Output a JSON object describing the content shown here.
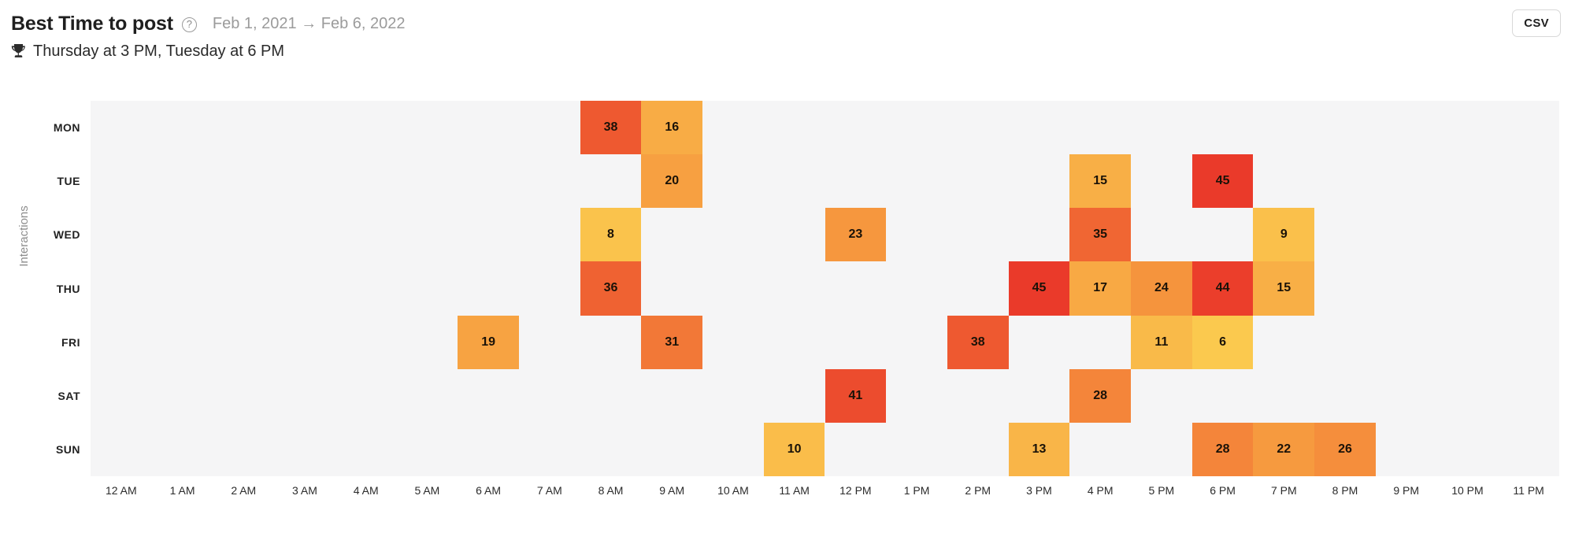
{
  "header": {
    "title": "Best Time to post",
    "help_icon": "question-circle-icon",
    "date_range": "Feb 1, 2021 → Feb 6, 2022",
    "csv_label": "CSV"
  },
  "subtitle": {
    "trophy_icon": "trophy-icon",
    "text": "Thursday at 3 PM, Tuesday at 6 PM"
  },
  "chart_data": {
    "type": "heatmap",
    "title": "Best Time to post",
    "subtitle": "Thursday at 3 PM, Tuesday at 6 PM",
    "xlabel": "",
    "ylabel": "Interactions",
    "date_range": "Feb 1, 2021 → Feb 6, 2022",
    "grid": false,
    "legend": "none",
    "x_categories": [
      "12 AM",
      "1 AM",
      "2 AM",
      "3 AM",
      "4 AM",
      "5 AM",
      "6 AM",
      "7 AM",
      "8 AM",
      "9 AM",
      "10 AM",
      "11 AM",
      "12 PM",
      "1 PM",
      "2 PM",
      "3 PM",
      "4 PM",
      "5 PM",
      "6 PM",
      "7 PM",
      "8 PM",
      "9 PM",
      "10 PM",
      "11 PM"
    ],
    "y_categories": [
      "MON",
      "TUE",
      "WED",
      "THU",
      "FRI",
      "SAT",
      "SUN"
    ],
    "value_range": [
      6,
      45
    ],
    "colors": {
      "plot_background": "#f5f5f6",
      "low": "#fbc94e",
      "mid": "#f5903c",
      "high": "#ea3a2a",
      "text": "#1a1208"
    },
    "values": [
      [
        null,
        null,
        null,
        null,
        null,
        null,
        null,
        null,
        38,
        16,
        null,
        null,
        null,
        null,
        null,
        null,
        null,
        null,
        null,
        null,
        null,
        null,
        null,
        null
      ],
      [
        null,
        null,
        null,
        null,
        null,
        null,
        null,
        null,
        null,
        20,
        null,
        null,
        null,
        null,
        null,
        null,
        15,
        null,
        45,
        null,
        null,
        null,
        null,
        null
      ],
      [
        null,
        null,
        null,
        null,
        null,
        null,
        null,
        null,
        8,
        null,
        null,
        null,
        23,
        null,
        null,
        null,
        35,
        null,
        null,
        9,
        null,
        null,
        null,
        null
      ],
      [
        null,
        null,
        null,
        null,
        null,
        null,
        null,
        null,
        36,
        null,
        null,
        null,
        null,
        null,
        null,
        45,
        17,
        24,
        44,
        15,
        null,
        null,
        null,
        null
      ],
      [
        null,
        null,
        null,
        null,
        null,
        null,
        19,
        null,
        null,
        31,
        null,
        null,
        null,
        null,
        38,
        null,
        null,
        11,
        6,
        null,
        null,
        null,
        null,
        null
      ],
      [
        null,
        null,
        null,
        null,
        null,
        null,
        null,
        null,
        null,
        null,
        null,
        null,
        41,
        null,
        null,
        null,
        28,
        null,
        null,
        null,
        null,
        null,
        null,
        null
      ],
      [
        null,
        null,
        null,
        null,
        null,
        null,
        null,
        null,
        null,
        null,
        null,
        10,
        null,
        null,
        null,
        13,
        null,
        null,
        28,
        22,
        26,
        null,
        null,
        null
      ]
    ],
    "cells": [
      {
        "day": "MON",
        "hour": "8 AM",
        "row": 0,
        "col": 8,
        "value": 38
      },
      {
        "day": "MON",
        "hour": "9 AM",
        "row": 0,
        "col": 9,
        "value": 16
      },
      {
        "day": "TUE",
        "hour": "9 AM",
        "row": 1,
        "col": 9,
        "value": 20
      },
      {
        "day": "TUE",
        "hour": "4 PM",
        "row": 1,
        "col": 16,
        "value": 15
      },
      {
        "day": "TUE",
        "hour": "6 PM",
        "row": 1,
        "col": 18,
        "value": 45
      },
      {
        "day": "WED",
        "hour": "8 AM",
        "row": 2,
        "col": 8,
        "value": 8
      },
      {
        "day": "WED",
        "hour": "12 PM",
        "row": 2,
        "col": 12,
        "value": 23
      },
      {
        "day": "WED",
        "hour": "4 PM",
        "row": 2,
        "col": 16,
        "value": 35
      },
      {
        "day": "WED",
        "hour": "7 PM",
        "row": 2,
        "col": 19,
        "value": 9
      },
      {
        "day": "THU",
        "hour": "8 AM",
        "row": 3,
        "col": 8,
        "value": 36
      },
      {
        "day": "THU",
        "hour": "3 PM",
        "row": 3,
        "col": 15,
        "value": 45
      },
      {
        "day": "THU",
        "hour": "4 PM",
        "row": 3,
        "col": 16,
        "value": 17
      },
      {
        "day": "THU",
        "hour": "5 PM",
        "row": 3,
        "col": 17,
        "value": 24
      },
      {
        "day": "THU",
        "hour": "6 PM",
        "row": 3,
        "col": 18,
        "value": 44
      },
      {
        "day": "THU",
        "hour": "7 PM",
        "row": 3,
        "col": 19,
        "value": 15
      },
      {
        "day": "FRI",
        "hour": "6 AM",
        "row": 4,
        "col": 6,
        "value": 19
      },
      {
        "day": "FRI",
        "hour": "9 AM",
        "row": 4,
        "col": 9,
        "value": 31
      },
      {
        "day": "FRI",
        "hour": "2 PM",
        "row": 4,
        "col": 14,
        "value": 38
      },
      {
        "day": "FRI",
        "hour": "5 PM",
        "row": 4,
        "col": 17,
        "value": 11
      },
      {
        "day": "FRI",
        "hour": "6 PM",
        "row": 4,
        "col": 18,
        "value": 6
      },
      {
        "day": "SAT",
        "hour": "12 PM",
        "row": 5,
        "col": 12,
        "value": 41
      },
      {
        "day": "SAT",
        "hour": "4 PM",
        "row": 5,
        "col": 16,
        "value": 28
      },
      {
        "day": "SUN",
        "hour": "11 AM",
        "row": 6,
        "col": 11,
        "value": 10
      },
      {
        "day": "SUN",
        "hour": "3 PM",
        "row": 6,
        "col": 15,
        "value": 13
      },
      {
        "day": "SUN",
        "hour": "6 PM",
        "row": 6,
        "col": 18,
        "value": 28
      },
      {
        "day": "SUN",
        "hour": "7 PM",
        "row": 6,
        "col": 19,
        "value": 22
      },
      {
        "day": "SUN",
        "hour": "8 PM",
        "row": 6,
        "col": 20,
        "value": 26
      }
    ]
  }
}
